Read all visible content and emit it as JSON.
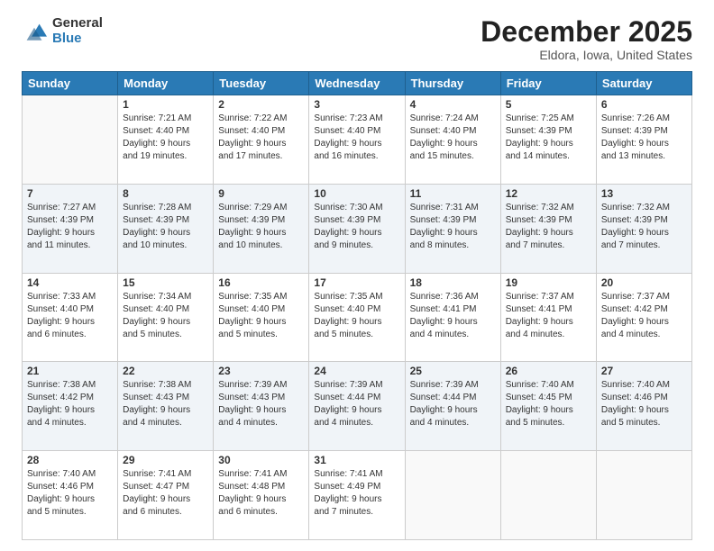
{
  "logo": {
    "general": "General",
    "blue": "Blue"
  },
  "header": {
    "title": "December 2025",
    "subtitle": "Eldora, Iowa, United States"
  },
  "weekdays": [
    "Sunday",
    "Monday",
    "Tuesday",
    "Wednesday",
    "Thursday",
    "Friday",
    "Saturday"
  ],
  "weeks": [
    [
      {
        "day": "",
        "empty": true
      },
      {
        "day": "1",
        "sunrise": "7:21 AM",
        "sunset": "4:40 PM",
        "daylight": "9 hours and 19 minutes."
      },
      {
        "day": "2",
        "sunrise": "7:22 AM",
        "sunset": "4:40 PM",
        "daylight": "9 hours and 17 minutes."
      },
      {
        "day": "3",
        "sunrise": "7:23 AM",
        "sunset": "4:40 PM",
        "daylight": "9 hours and 16 minutes."
      },
      {
        "day": "4",
        "sunrise": "7:24 AM",
        "sunset": "4:40 PM",
        "daylight": "9 hours and 15 minutes."
      },
      {
        "day": "5",
        "sunrise": "7:25 AM",
        "sunset": "4:39 PM",
        "daylight": "9 hours and 14 minutes."
      },
      {
        "day": "6",
        "sunrise": "7:26 AM",
        "sunset": "4:39 PM",
        "daylight": "9 hours and 13 minutes."
      }
    ],
    [
      {
        "day": "7",
        "sunrise": "7:27 AM",
        "sunset": "4:39 PM",
        "daylight": "9 hours and 11 minutes."
      },
      {
        "day": "8",
        "sunrise": "7:28 AM",
        "sunset": "4:39 PM",
        "daylight": "9 hours and 10 minutes."
      },
      {
        "day": "9",
        "sunrise": "7:29 AM",
        "sunset": "4:39 PM",
        "daylight": "9 hours and 10 minutes."
      },
      {
        "day": "10",
        "sunrise": "7:30 AM",
        "sunset": "4:39 PM",
        "daylight": "9 hours and 9 minutes."
      },
      {
        "day": "11",
        "sunrise": "7:31 AM",
        "sunset": "4:39 PM",
        "daylight": "9 hours and 8 minutes."
      },
      {
        "day": "12",
        "sunrise": "7:32 AM",
        "sunset": "4:39 PM",
        "daylight": "9 hours and 7 minutes."
      },
      {
        "day": "13",
        "sunrise": "7:32 AM",
        "sunset": "4:39 PM",
        "daylight": "9 hours and 7 minutes."
      }
    ],
    [
      {
        "day": "14",
        "sunrise": "7:33 AM",
        "sunset": "4:40 PM",
        "daylight": "9 hours and 6 minutes."
      },
      {
        "day": "15",
        "sunrise": "7:34 AM",
        "sunset": "4:40 PM",
        "daylight": "9 hours and 5 minutes."
      },
      {
        "day": "16",
        "sunrise": "7:35 AM",
        "sunset": "4:40 PM",
        "daylight": "9 hours and 5 minutes."
      },
      {
        "day": "17",
        "sunrise": "7:35 AM",
        "sunset": "4:40 PM",
        "daylight": "9 hours and 5 minutes."
      },
      {
        "day": "18",
        "sunrise": "7:36 AM",
        "sunset": "4:41 PM",
        "daylight": "9 hours and 4 minutes."
      },
      {
        "day": "19",
        "sunrise": "7:37 AM",
        "sunset": "4:41 PM",
        "daylight": "9 hours and 4 minutes."
      },
      {
        "day": "20",
        "sunrise": "7:37 AM",
        "sunset": "4:42 PM",
        "daylight": "9 hours and 4 minutes."
      }
    ],
    [
      {
        "day": "21",
        "sunrise": "7:38 AM",
        "sunset": "4:42 PM",
        "daylight": "9 hours and 4 minutes."
      },
      {
        "day": "22",
        "sunrise": "7:38 AM",
        "sunset": "4:43 PM",
        "daylight": "9 hours and 4 minutes."
      },
      {
        "day": "23",
        "sunrise": "7:39 AM",
        "sunset": "4:43 PM",
        "daylight": "9 hours and 4 minutes."
      },
      {
        "day": "24",
        "sunrise": "7:39 AM",
        "sunset": "4:44 PM",
        "daylight": "9 hours and 4 minutes."
      },
      {
        "day": "25",
        "sunrise": "7:39 AM",
        "sunset": "4:44 PM",
        "daylight": "9 hours and 4 minutes."
      },
      {
        "day": "26",
        "sunrise": "7:40 AM",
        "sunset": "4:45 PM",
        "daylight": "9 hours and 5 minutes."
      },
      {
        "day": "27",
        "sunrise": "7:40 AM",
        "sunset": "4:46 PM",
        "daylight": "9 hours and 5 minutes."
      }
    ],
    [
      {
        "day": "28",
        "sunrise": "7:40 AM",
        "sunset": "4:46 PM",
        "daylight": "9 hours and 5 minutes."
      },
      {
        "day": "29",
        "sunrise": "7:41 AM",
        "sunset": "4:47 PM",
        "daylight": "9 hours and 6 minutes."
      },
      {
        "day": "30",
        "sunrise": "7:41 AM",
        "sunset": "4:48 PM",
        "daylight": "9 hours and 6 minutes."
      },
      {
        "day": "31",
        "sunrise": "7:41 AM",
        "sunset": "4:49 PM",
        "daylight": "9 hours and 7 minutes."
      },
      {
        "day": "",
        "empty": true
      },
      {
        "day": "",
        "empty": true
      },
      {
        "day": "",
        "empty": true
      }
    ]
  ]
}
